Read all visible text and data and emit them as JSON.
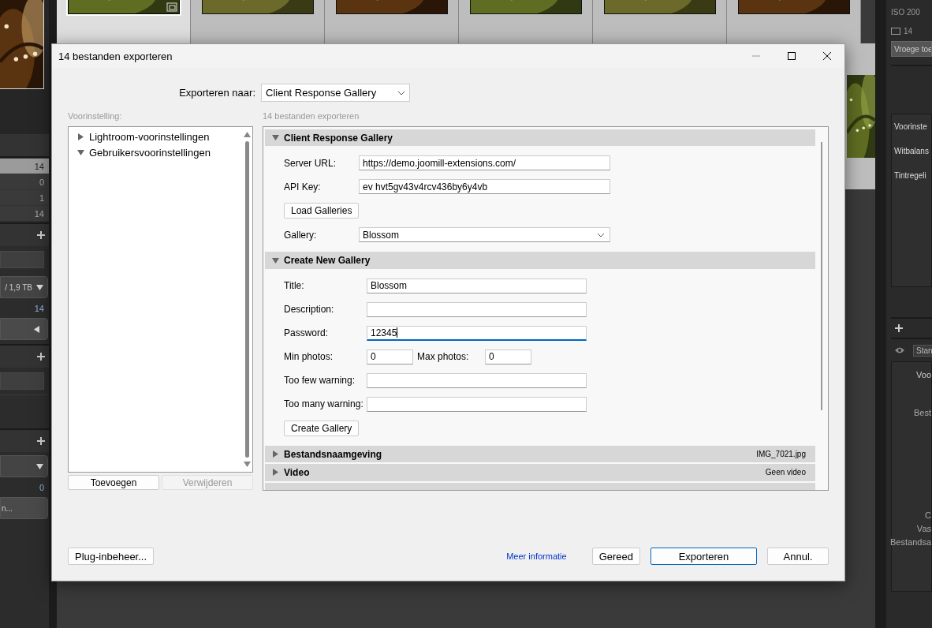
{
  "app": {
    "left_panel": [
      {
        "kind": "band"
      },
      {
        "kind": "count",
        "value": "14",
        "selected": true
      },
      {
        "kind": "count",
        "value": "0",
        "selected": false
      },
      {
        "kind": "count",
        "value": "1",
        "selected": false
      },
      {
        "kind": "count",
        "value": "14",
        "selected": false
      },
      {
        "kind": "section"
      },
      {
        "kind": "field"
      },
      {
        "kind": "dropdown",
        "text": "/ 1,9 TB"
      },
      {
        "kind": "stat",
        "value": "14"
      },
      {
        "kind": "button"
      },
      {
        "kind": "section"
      },
      {
        "kind": "field"
      },
      {
        "kind": "spacer"
      },
      {
        "kind": "section"
      },
      {
        "kind": "dropdown"
      },
      {
        "kind": "stat",
        "value": "0"
      },
      {
        "kind": "button",
        "text": "n..."
      }
    ],
    "thumbnails": [
      {
        "selected": true
      },
      {
        "selected": false
      },
      {
        "selected": false
      },
      {
        "selected": false
      },
      {
        "selected": false
      },
      {
        "selected": false
      }
    ],
    "right_panel": {
      "iso": "ISO 200",
      "count": "14",
      "dropdown": "Vroege toe",
      "settings": [
        "Voorinste",
        "Witbalans",
        "Tintregeli"
      ],
      "view_mode": "Stan",
      "metadata": [
        "Voo",
        "Best",
        "C",
        "Vas",
        "Bestandsa"
      ]
    }
  },
  "dialog": {
    "title": "14 bestanden exporteren",
    "export_to": {
      "label": "Exporteren naar:",
      "value": "Client Response Gallery"
    },
    "preset": {
      "label": "Voorinstelling:",
      "tree": [
        {
          "label": "Lightroom-voorinstellingen",
          "expanded": false
        },
        {
          "label": "Gebruikersvoorinstellingen",
          "expanded": true
        }
      ],
      "buttons": [
        {
          "label": "Toevoegen",
          "disabled": false
        },
        {
          "label": "Verwijderen",
          "disabled": true
        }
      ]
    },
    "settings": {
      "label": "14 bestanden exporteren",
      "sections": [
        {
          "title": "Client Response Gallery",
          "expanded": true,
          "fields": [
            {
              "kind": "text",
              "label": "Server URL:",
              "value": "https://demo.joomill-extensions.com/",
              "focused": false
            },
            {
              "kind": "text",
              "label": "API Key:",
              "value": "ev hvt5gv43v4rcv436by6y4vb",
              "focused": false
            },
            {
              "kind": "button",
              "label": "Load Galleries"
            },
            {
              "kind": "select",
              "label": "Gallery:",
              "value": "Blossom"
            }
          ]
        },
        {
          "title": "Create New Gallery",
          "expanded": true,
          "fields": [
            {
              "kind": "text",
              "label": "Title:",
              "value": "Blossom",
              "focused": false
            },
            {
              "kind": "text",
              "label": "Description:",
              "focused": false
            },
            {
              "kind": "text",
              "label": "Password:",
              "value": "12345",
              "focused": true
            },
            {
              "kind": "pair",
              "label": "Min photos:",
              "value": "0",
              "label_2": "Max photos:",
              "value_2": "0"
            },
            {
              "kind": "text",
              "label": "Too few warning:",
              "focused": false
            },
            {
              "kind": "text",
              "label": "Too many warning:",
              "focused": false
            },
            {
              "kind": "button",
              "label": "Create Gallery"
            }
          ]
        },
        {
          "title": "Bestandsnaamgeving",
          "expanded": false,
          "summary": "IMG_7021.jpg"
        },
        {
          "title": "Video",
          "expanded": false,
          "summary": "Geen video"
        }
      ]
    },
    "footer": {
      "plugin_button": "Plug-inbeheer...",
      "link": "Meer informatie",
      "buttons": [
        {
          "label": "Gereed",
          "default": false
        },
        {
          "label": "Exporteren",
          "default": true
        },
        {
          "label": "Annul.",
          "default": false
        }
      ]
    }
  }
}
